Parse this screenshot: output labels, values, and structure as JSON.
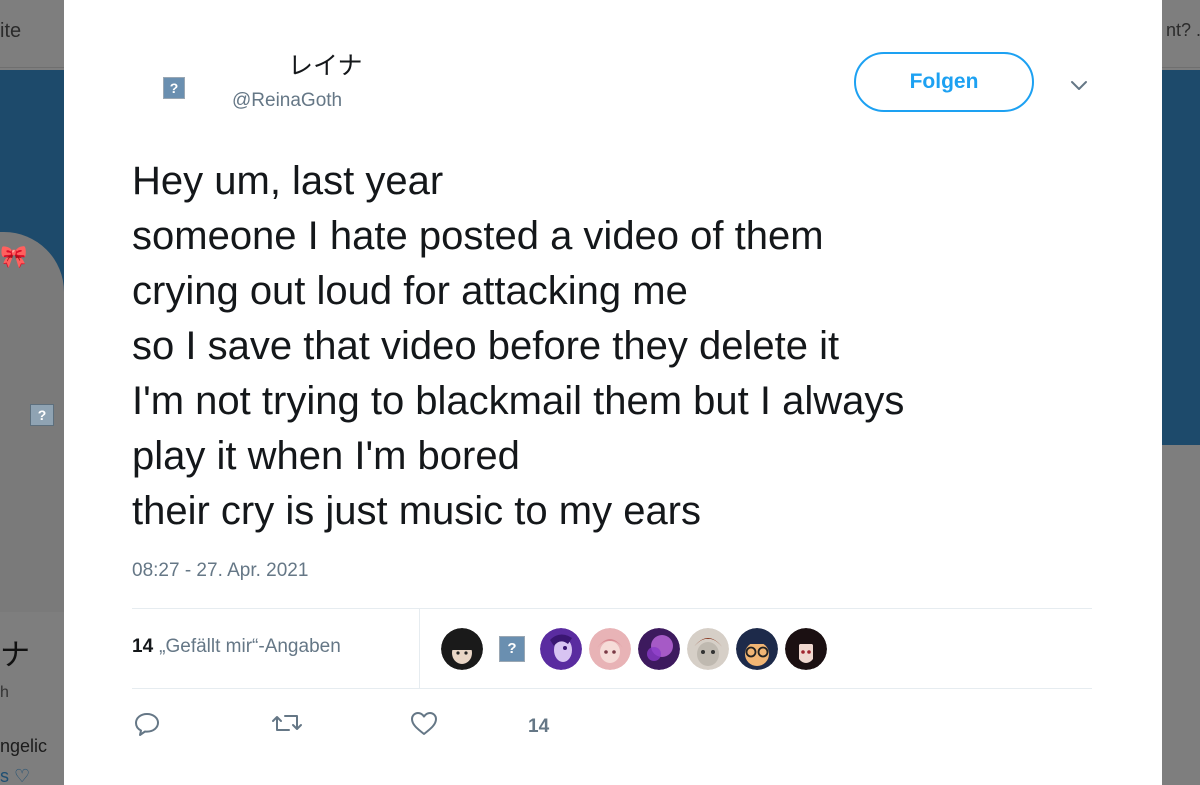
{
  "background": {
    "top_left_text": "ite",
    "top_right_text": "nt? .",
    "avatar_glyph": "?",
    "profile_name": "ナ",
    "profile_handle": "h",
    "bio_line1": "ngelic",
    "bio_line2": "s ♡"
  },
  "tweet": {
    "display_name": "レイナ",
    "handle": "@ReinaGoth",
    "avatar_glyph": "?",
    "follow_label": "Folgen",
    "text_lines": [
      "Hey um, last year",
      "someone I hate posted a video of them",
      "crying out loud for attacking me",
      "so I save that video before they delete it",
      "I'm not trying to blackmail them but I always",
      "play it when I'm bored",
      "their cry is just music to my ears"
    ],
    "timestamp": "08:27 - 27. Apr. 2021",
    "likes_count": "14",
    "likes_label": "„Gefällt mir“-Angaben",
    "like_action_count": "14"
  },
  "likers": [
    {
      "icon": "avatar-dark-hair",
      "colors": [
        "#1a1a1a",
        "#e9d6c6"
      ]
    },
    {
      "icon": "avatar-placeholder",
      "glyph": "?"
    },
    {
      "icon": "avatar-purple-character",
      "colors": [
        "#5a2ca0",
        "#d8c4f2"
      ]
    },
    {
      "icon": "avatar-pink-hair",
      "colors": [
        "#e8b3b6",
        "#f6dcd8"
      ]
    },
    {
      "icon": "avatar-purple-glow",
      "colors": [
        "#3d1a5e",
        "#c06ae0"
      ]
    },
    {
      "icon": "avatar-red-hair-mask",
      "colors": [
        "#8a3a22",
        "#bfb9b0"
      ]
    },
    {
      "icon": "avatar-orange-glasses",
      "colors": [
        "#1d2a4a",
        "#f1b574"
      ]
    },
    {
      "icon": "avatar-black-hair",
      "colors": [
        "#1b1012",
        "#f0d8d0"
      ]
    }
  ],
  "colors": {
    "accent": "#1da1f2",
    "text_primary": "#14171a",
    "text_secondary": "#657786",
    "divider": "#e6ecf0"
  }
}
